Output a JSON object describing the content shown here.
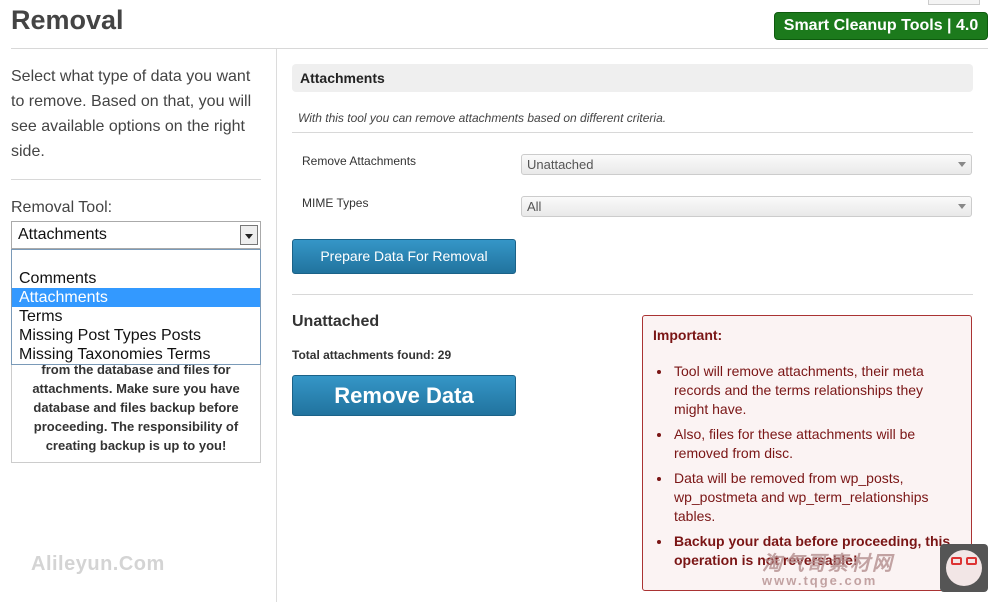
{
  "header": {
    "title": "Removal",
    "badge": "Smart Cleanup Tools | 4.0"
  },
  "sidebar": {
    "intro": "Select what type of data you want to remove. Based on that, you will see available options on the right side.",
    "tool_label": "Removal Tool:",
    "tool_selected": "Attachments",
    "tool_options": [
      "Comments",
      "Attachments",
      "Terms",
      "Missing Post Types Posts",
      "Missing Taxonomies Terms"
    ],
    "warning": "from the database and files for attachments. Make sure you have database and files backup before proceeding. The responsibility of creating backup is up to you!"
  },
  "panel": {
    "title": "Attachments",
    "description": "With this tool you can remove attachments based on different criteria.",
    "fields": [
      {
        "label": "Remove Attachments",
        "value": "Unattached"
      },
      {
        "label": "MIME Types",
        "value": "All"
      }
    ],
    "prepare_label": "Prepare Data For Removal",
    "result_title": "Unattached",
    "result_count": "Total attachments found: 29",
    "remove_label": "Remove Data"
  },
  "important": {
    "title": "Important:",
    "items": [
      "Tool will remove attachments, their meta records and the terms relationships they might have.",
      "Also, files for these attachments will be removed from disc.",
      "Data will be removed from wp_posts, wp_postmeta and wp_term_relationships tables.",
      "Backup your data before proceeding, this operation is not reversable!"
    ]
  },
  "watermarks": {
    "left": "Alileyun.Com",
    "right_cn": "淘气哥素材网",
    "right_url": "www.tqge.com"
  },
  "colors": {
    "badge": "#1c7a1c",
    "button": "#2a84b3",
    "important_border": "#aa3333",
    "important_text": "#7a1515",
    "selected_option": "#3399ff"
  }
}
